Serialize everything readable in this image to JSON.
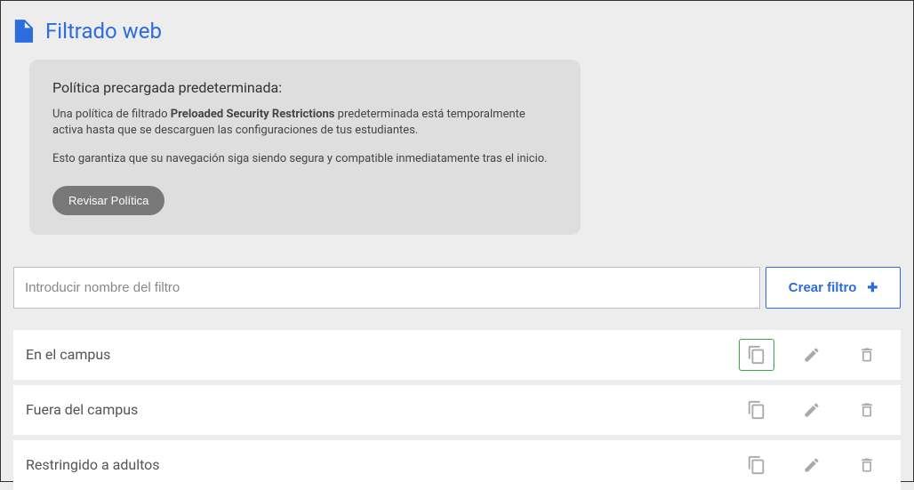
{
  "header": {
    "title": "Filtrado web"
  },
  "info_card": {
    "title": "Política precargada predeterminada:",
    "body1_pre": "Una política de filtrado ",
    "body1_bold": "Preloaded Security Restrictions",
    "body1_post": " predeterminada está temporalmente activa hasta que se descarguen las configuraciones de tus estudiantes.",
    "body2": "Esto garantiza que su navegación siga siendo segura y compatible inmediatamente tras el inicio.",
    "button_label": "Revisar Política"
  },
  "filter_create": {
    "placeholder": "Introducir nombre del filtro",
    "button_label": "Crear filtro"
  },
  "filters": [
    {
      "name": "En el campus",
      "highlight_copy": true
    },
    {
      "name": "Fuera del campus",
      "highlight_copy": false
    },
    {
      "name": "Restringido a adultos",
      "highlight_copy": false
    }
  ]
}
